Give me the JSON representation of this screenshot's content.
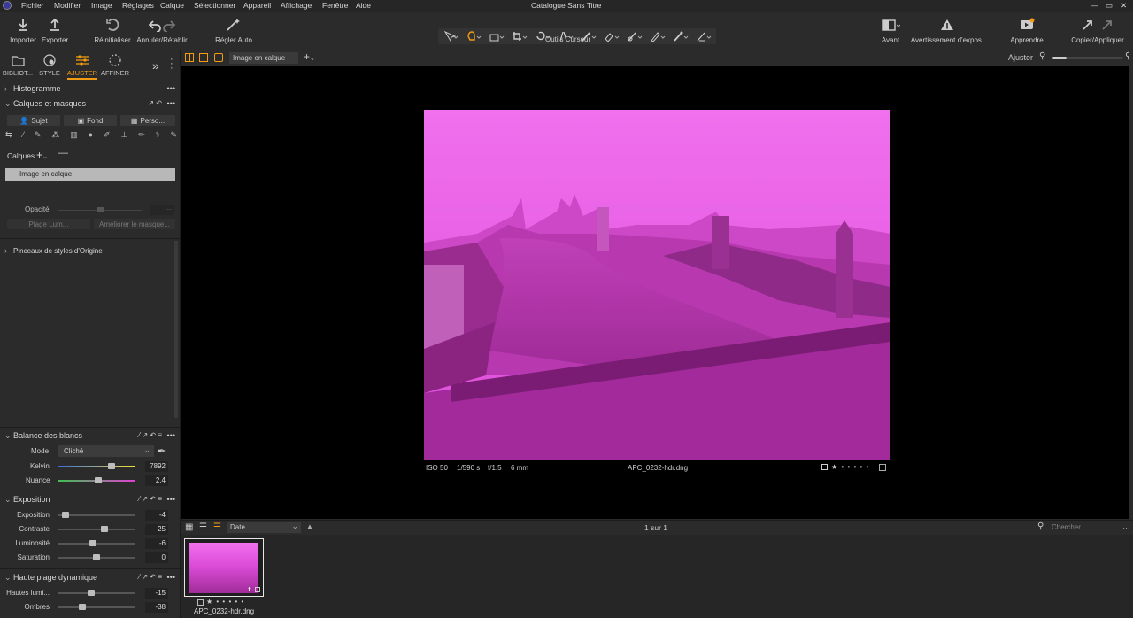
{
  "menu": [
    "Fichier",
    "Modifier",
    "Image",
    "Réglages",
    "Calque",
    "Sélectionner",
    "Appareil",
    "Affichage",
    "Fenêtre",
    "Aide"
  ],
  "window_title": "Catalogue Sans Titre",
  "toolbar": {
    "import": "Importer",
    "export": "Exporter",
    "reset": "Réinitialiser",
    "undo_redo": "Annuler/Rétablir",
    "auto": "Régler Auto",
    "cursor_tools": "Outils Curseur",
    "before": "Avant",
    "exposure_warning": "Avertissement d'expos.",
    "learn": "Apprendre",
    "copy_apply": "Copier/Appliquer"
  },
  "tabs": [
    "BIBLIOT...",
    "STYLE",
    "AJUSTER",
    "AFFINER"
  ],
  "active_tab": "AJUSTER",
  "sections": {
    "histogram": "Histogramme",
    "layers_masks": "Calques et masques",
    "mask_buttons": [
      "Sujet",
      "Fond",
      "Perso..."
    ],
    "layers_label": "Calques",
    "layer_selected": "Image en calque",
    "opacity_label": "Opacité",
    "opacity_value": "...",
    "plage_btn": "Plage Lum...",
    "ameliorer_btn": "Améliorer le masque...",
    "brushes": "Pinceaux de styles d'Origine",
    "wb": "Balance des blancs",
    "wb_mode_label": "Mode",
    "wb_mode_value": "Cliché",
    "kelvin_label": "Kelvin",
    "kelvin_value": "7892",
    "kelvin_level": 0.72,
    "tint_label": "Nuance",
    "tint_value": "2,4",
    "tint_level": 0.53,
    "exposure": "Exposition",
    "hdr": "Haute plage dynamique"
  },
  "exposure_rows": [
    {
      "label": "Exposition",
      "value": "-4",
      "level": 0.05
    },
    {
      "label": "Contraste",
      "value": "25",
      "level": 0.62
    },
    {
      "label": "Luminosité",
      "value": "-6",
      "level": 0.45
    },
    {
      "label": "Saturation",
      "value": "0",
      "level": 0.5
    }
  ],
  "hdr_rows": [
    {
      "label": "Hautes lumi...",
      "value": "-15",
      "level": 0.42
    },
    {
      "label": "Ombres",
      "value": "-38",
      "level": 0.3
    }
  ],
  "viewer": {
    "dropdown": "Image en calque",
    "zoom_label": "Ajuster",
    "iso": "ISO 50",
    "shutter": "1/590 s",
    "aperture": "f/1.5",
    "focal": "6 mm",
    "filename": "APC_0232-hdr.dng",
    "rating_stars": "★ • • • • •"
  },
  "browser": {
    "sort": "Date",
    "count": "1 sur 1",
    "search_placeholder": "Chercher",
    "thumb_name": "APC_0232-hdr.dng",
    "thumb_stars": "★ • • • • •"
  },
  "colors": {
    "accent": "#f39c12",
    "photo_tint": "#e040d8"
  }
}
